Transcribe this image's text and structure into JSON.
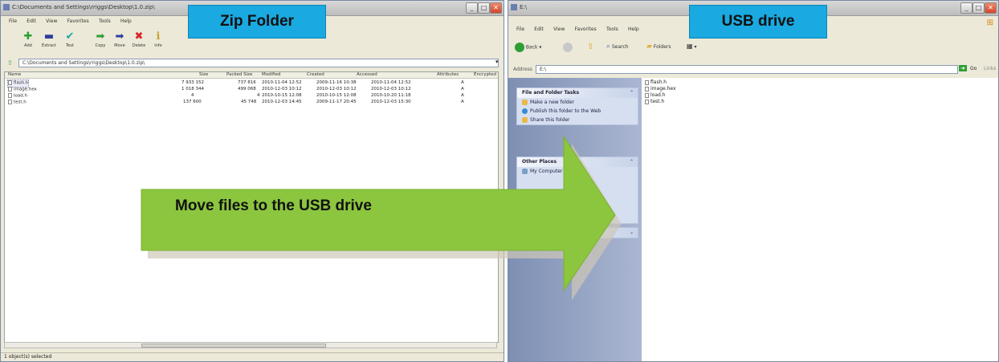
{
  "zip_window": {
    "title": "C:\\Documents and Settings\\rriggs\\Desktop\\1.0.zip\\",
    "menu": [
      "File",
      "Edit",
      "View",
      "Favorites",
      "Tools",
      "Help"
    ],
    "toolbar": [
      "Add",
      "Extract",
      "Test",
      "Copy",
      "Move",
      "Delete",
      "Info"
    ],
    "address": "C:\\Documents and Settings\\rriggs\\Desktop\\1.0.zip\\",
    "columns": [
      "Name",
      "Size",
      "Packed Size",
      "Modified",
      "Created",
      "Accessed",
      "Attributes",
      "Encrypted"
    ],
    "files": [
      {
        "name": "flash.h",
        "size": "7 933 152",
        "packed": "737 816",
        "modified": "2010-11-04 12:52",
        "created": "2009-11-16 10:38",
        "accessed": "2010-11-04 12:52",
        "attr": "A"
      },
      {
        "name": "image.hex",
        "size": "1 018 344",
        "packed": "499 068",
        "modified": "2010-12-03 10:12",
        "created": "2010-12-03 10:12",
        "accessed": "2010-12-03 10:12",
        "attr": "A"
      },
      {
        "name": "load.h",
        "size": "4",
        "packed": "4",
        "modified": "2010-10-15 12:08",
        "created": "2010-10-15 12:08",
        "accessed": "2010-10-20 11:18",
        "attr": "A"
      },
      {
        "name": "test.h",
        "size": "137 600",
        "packed": "45 748",
        "modified": "2010-12-03 14:45",
        "created": "2009-11-17 20:45",
        "accessed": "2010-12-03 15:30",
        "attr": "A"
      }
    ],
    "status": "1 object(s) selected"
  },
  "usb_window": {
    "title": "E:\\",
    "menu": [
      "File",
      "Edit",
      "View",
      "Favorites",
      "Tools",
      "Help"
    ],
    "nav": {
      "back": "Back",
      "search": "Search",
      "folders": "Folders"
    },
    "address_label": "Address",
    "address": "E:\\",
    "go": "Go",
    "links": "Links",
    "file_folder_tasks": {
      "heading": "File and Folder Tasks",
      "items": [
        "Make a new folder",
        "Publish this folder to the Web",
        "Share this folder"
      ]
    },
    "other_places": {
      "heading": "Other Places",
      "items": [
        "My Computer"
      ]
    },
    "details": {
      "heading": "Details"
    },
    "files": [
      "flash.h",
      "image.hex",
      "load.h",
      "test.h"
    ]
  },
  "callouts": {
    "zip": "Zip Folder",
    "usb": "USB drive",
    "arrow": "Move files to the USB drive"
  },
  "colors": {
    "callout": "#1aa9e0",
    "arrow": "#8cc63f"
  }
}
